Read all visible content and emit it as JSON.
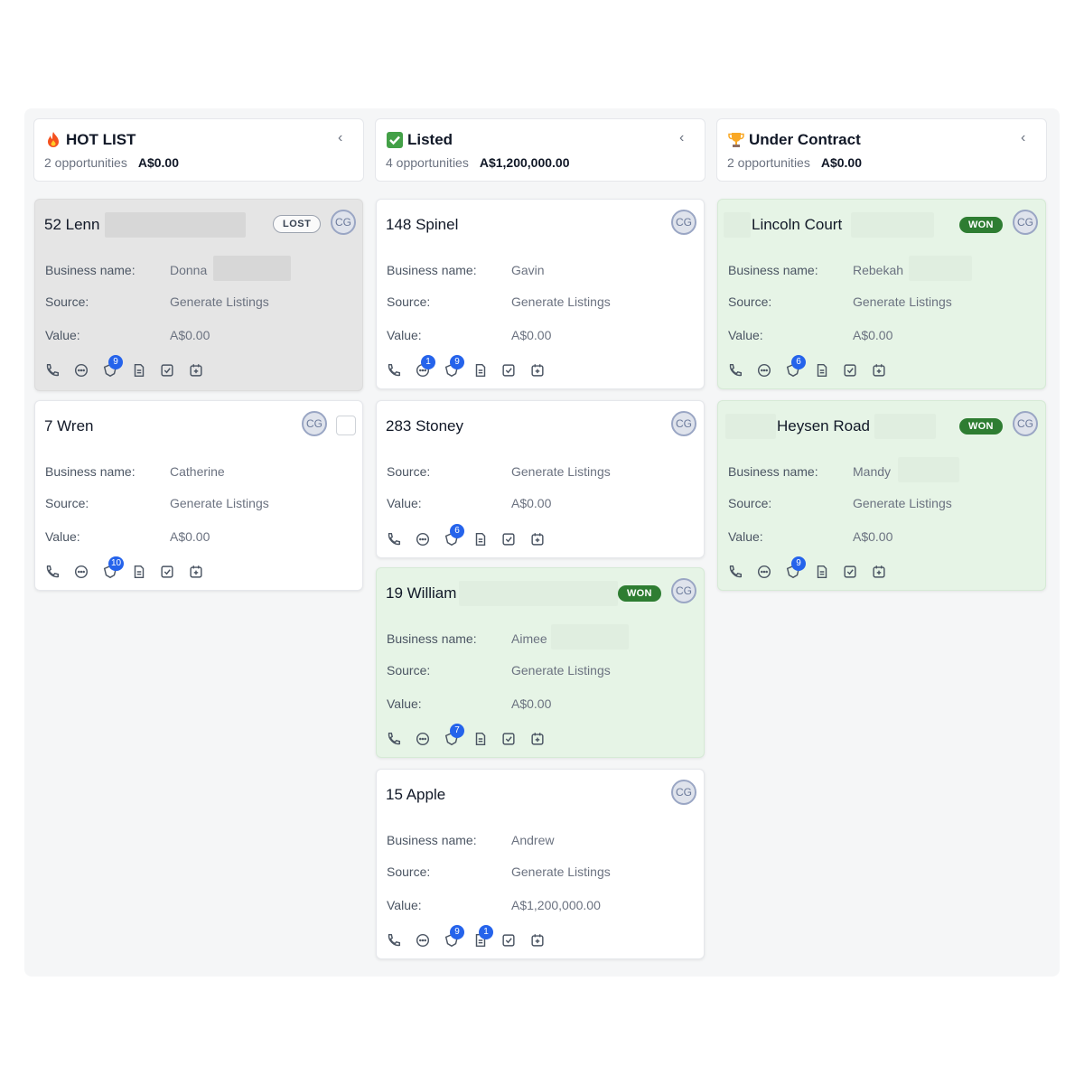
{
  "columns": [
    {
      "title": "HOT LIST",
      "icon": "fire-icon",
      "count_text": "2 opportunities",
      "total": "A$0.00",
      "cards": [
        {
          "title": "52 Lenn",
          "status": "LOST",
          "avatar": "CG",
          "business_name": "Donna",
          "source": "Generate Listings",
          "value": "A$0.00",
          "counts": {
            "opportunity": "9"
          }
        },
        {
          "title": "7 Wren",
          "status": "",
          "avatar": "CG",
          "business_name": "Catherine",
          "source": "Generate Listings",
          "value": "A$0.00",
          "counts": {
            "opportunity": "10"
          }
        }
      ]
    },
    {
      "title": "Listed",
      "icon": "check-box-icon",
      "count_text": "4 opportunities",
      "total": "A$1,200,000.00",
      "cards": [
        {
          "title": "148 Spinel",
          "status": "",
          "avatar": "CG",
          "business_name": "Gavin",
          "source": "Generate Listings",
          "value": "A$0.00",
          "counts": {
            "sms": "1",
            "opportunity": "9"
          }
        },
        {
          "title": "283 Stoney",
          "status": "",
          "avatar": "CG",
          "business_name": "",
          "source": "Generate Listings",
          "value": "A$0.00",
          "counts": {
            "opportunity": "6"
          }
        },
        {
          "title": "19 William",
          "status": "WON",
          "avatar": "CG",
          "business_name": "Aimee",
          "source": "Generate Listings",
          "value": "A$0.00",
          "counts": {
            "opportunity": "7"
          }
        },
        {
          "title": "15 Apple",
          "status": "",
          "avatar": "CG",
          "business_name": "Andrew",
          "source": "Generate Listings",
          "value": "A$1,200,000.00",
          "counts": {
            "opportunity": "9",
            "notes": "1"
          }
        }
      ]
    },
    {
      "title": "Under Contract",
      "icon": "trophy-icon",
      "count_text": "2 opportunities",
      "total": "A$0.00",
      "cards": [
        {
          "title": "Lincoln Court",
          "status": "WON",
          "avatar": "CG",
          "business_name": "Rebekah",
          "source": "Generate Listings",
          "value": "A$0.00",
          "counts": {
            "opportunity": "6"
          }
        },
        {
          "title": "Heysen Road",
          "status": "WON",
          "avatar": "CG",
          "business_name": "Mandy",
          "source": "Generate Listings",
          "value": "A$0.00",
          "counts": {
            "opportunity": "9"
          }
        }
      ]
    }
  ],
  "labels": {
    "business_name": "Business name:",
    "source": "Source:",
    "value": "Value:"
  },
  "colors": {
    "won_badge": "#2e7d32",
    "won_card": "#e6f4e6",
    "lost_card": "#e5e5e5",
    "count_badge": "#2563eb"
  }
}
